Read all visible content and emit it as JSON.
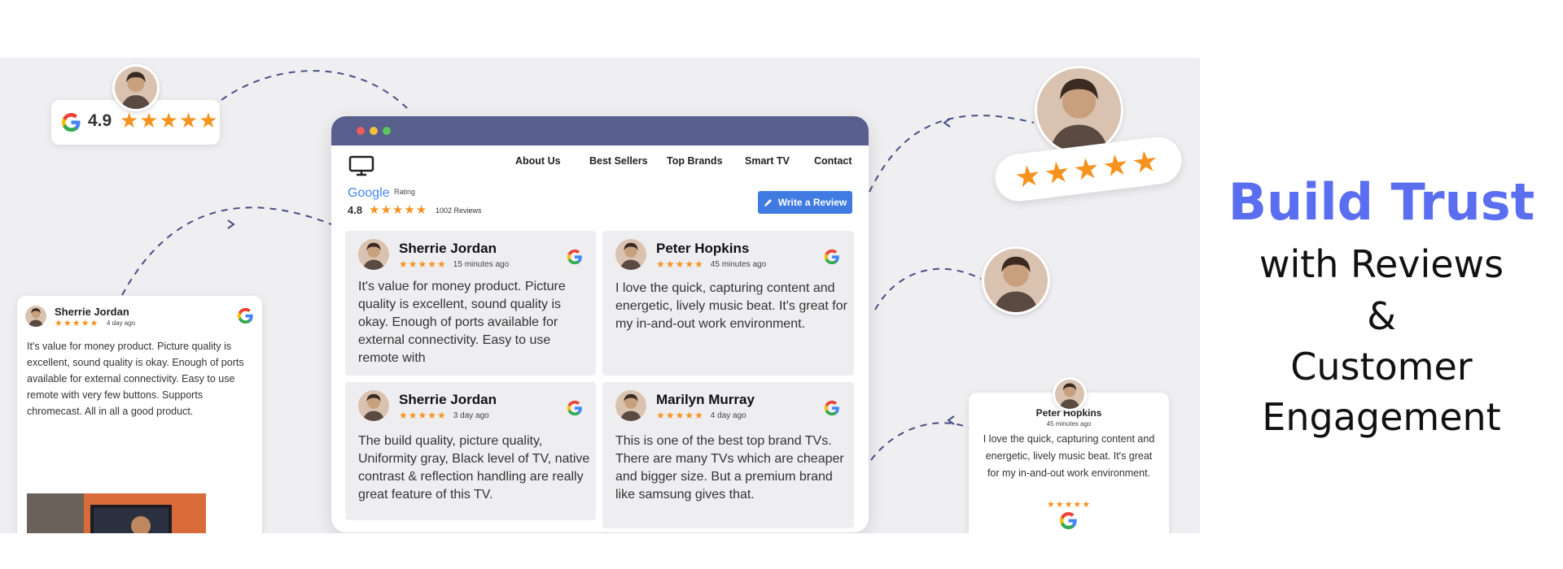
{
  "colors": {
    "accent_blue": "#5b6ef0",
    "window_bar": "#595f8c",
    "star": "#f6921e",
    "button": "#3f7be0"
  },
  "headline": {
    "title": "Build Trust",
    "line1": "with Reviews",
    "line2": "&",
    "line3": "Customer",
    "line4": "Engagement"
  },
  "badge_rating": {
    "score": "4.9",
    "stars": "★★★★★"
  },
  "floating_stars": "★★★★★",
  "window": {
    "nav": [
      "About Us",
      "Best Sellers",
      "Top Brands",
      "Smart TV",
      "Contact"
    ],
    "google_label": "Google",
    "rating_label": "Rating",
    "rating_score": "4.8",
    "rating_stars": "★★★★★",
    "reviews_count": "1002 Reviews",
    "write_review": "Write a Review",
    "reviews": [
      {
        "name": "Sherrie Jordan",
        "stars": "★★★★★",
        "time": "15 minutes ago",
        "text": "It's value for money product. Picture quality is excellent, sound quality is okay. Enough of ports available for external connectivity. Easy to use remote with"
      },
      {
        "name": "Peter Hopkins",
        "stars": "★★★★★",
        "time": "45 minutes ago",
        "text": "I love the quick, capturing content and energetic, lively music beat. It's great for my in-and-out work environment."
      },
      {
        "name": "Sherrie Jordan",
        "stars": "★★★★★",
        "time": "3 day ago",
        "text": "The build quality, picture quality, Uniformity gray, Black level of TV, native contrast & reflection handling are really great feature of this TV."
      },
      {
        "name": "Marilyn Murray",
        "stars": "★★★★★",
        "time": "4 day ago",
        "text": "This is one of the best top brand TVs. There are many TVs which are cheaper and bigger size. But a premium brand like samsung gives that."
      }
    ]
  },
  "left_card": {
    "name": "Sherrie Jordan",
    "stars": "★★★★★",
    "time": "4 day ago",
    "text": "It's value for money product. Picture quality is excellent, sound quality is okay. Enough of ports available for external connectivity. Easy to use remote with very few buttons. Supports chromecast. All in all a good product."
  },
  "right_card": {
    "name": "Peter Hopkins",
    "time": "45 minutes ago",
    "text": "I love the quick, capturing content and energetic, lively music beat. It's great for my in-and-out work environment.",
    "stars": "★★★★★"
  }
}
